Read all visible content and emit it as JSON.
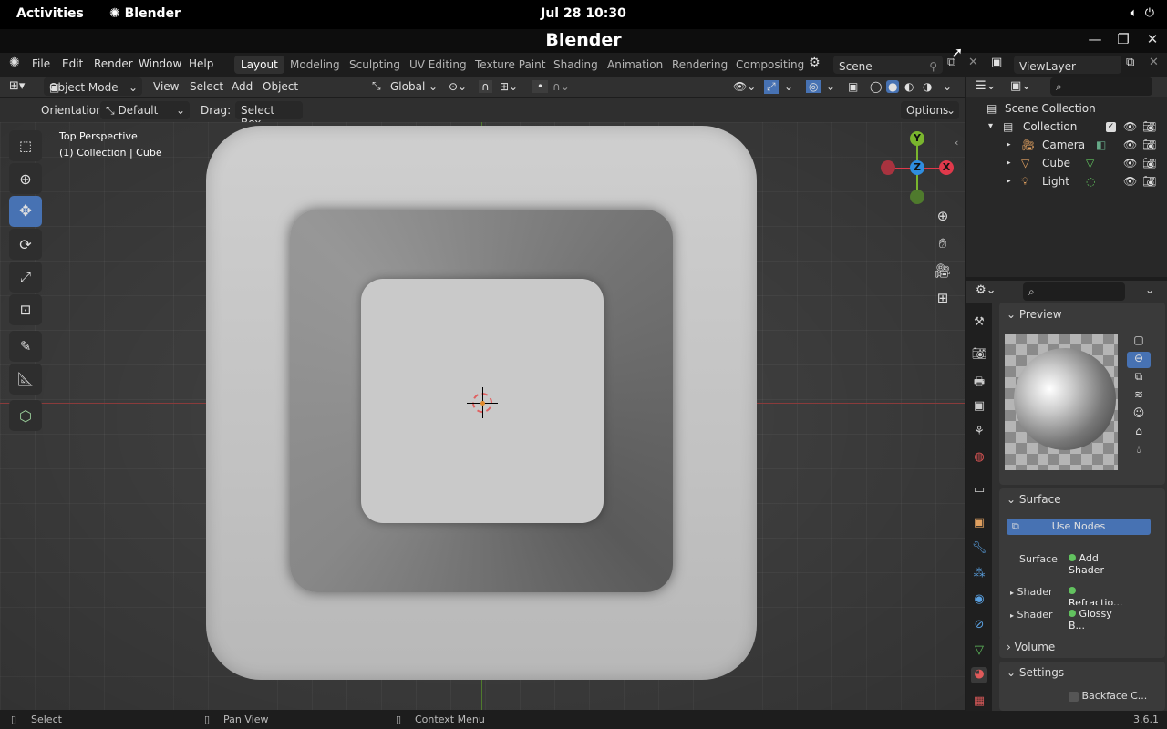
{
  "system_bar": {
    "activities": "Activities",
    "app_name": "Blender",
    "clock": "Jul 28  10:30"
  },
  "window": {
    "title": "Blender"
  },
  "menu": [
    "File",
    "Edit",
    "Render",
    "Window",
    "Help"
  ],
  "workspaces": [
    "Layout",
    "Modeling",
    "Sculpting",
    "UV Editing",
    "Texture Paint",
    "Shading",
    "Animation",
    "Rendering",
    "Compositing"
  ],
  "scene": {
    "scene_name": "Scene",
    "view_layer": "ViewLayer"
  },
  "viewport_header": {
    "mode": "Object Mode",
    "view": "View",
    "select": "Select",
    "add": "Add",
    "object": "Object",
    "orientation_global": "Global"
  },
  "tool_settings": {
    "orientation_label": "Orientation:",
    "orientation_value": "Default",
    "drag_label": "Drag:",
    "drag_value": "Select Box",
    "options": "Options"
  },
  "viewport": {
    "view_name": "Top Perspective",
    "context": "(1) Collection | Cube"
  },
  "outliner": {
    "scene_collection": "Scene Collection",
    "collection": "Collection",
    "items": [
      {
        "name": "Camera"
      },
      {
        "name": "Cube"
      },
      {
        "name": "Light"
      }
    ]
  },
  "properties": {
    "preview": "Preview",
    "surface_panel": "Surface",
    "use_nodes": "Use Nodes",
    "surface_label": "Surface",
    "surface_value": "Add Shader",
    "shader1_label": "Shader",
    "shader1_value": "Refractio...",
    "shader2_label": "Shader",
    "shader2_value": "Glossy B...",
    "volume": "Volume",
    "settings": "Settings",
    "backface": "Backface C..."
  },
  "gizmo": {
    "x": "X",
    "y": "Y",
    "z": "Z"
  },
  "statusbar": {
    "select": "Select",
    "pan": "Pan View",
    "context": "Context Menu",
    "version": "3.6.1"
  },
  "colors": {
    "accent": "#4772b3",
    "x_axis": "#e0394b",
    "y_axis": "#7ab52e",
    "z_axis": "#2f8de0"
  }
}
